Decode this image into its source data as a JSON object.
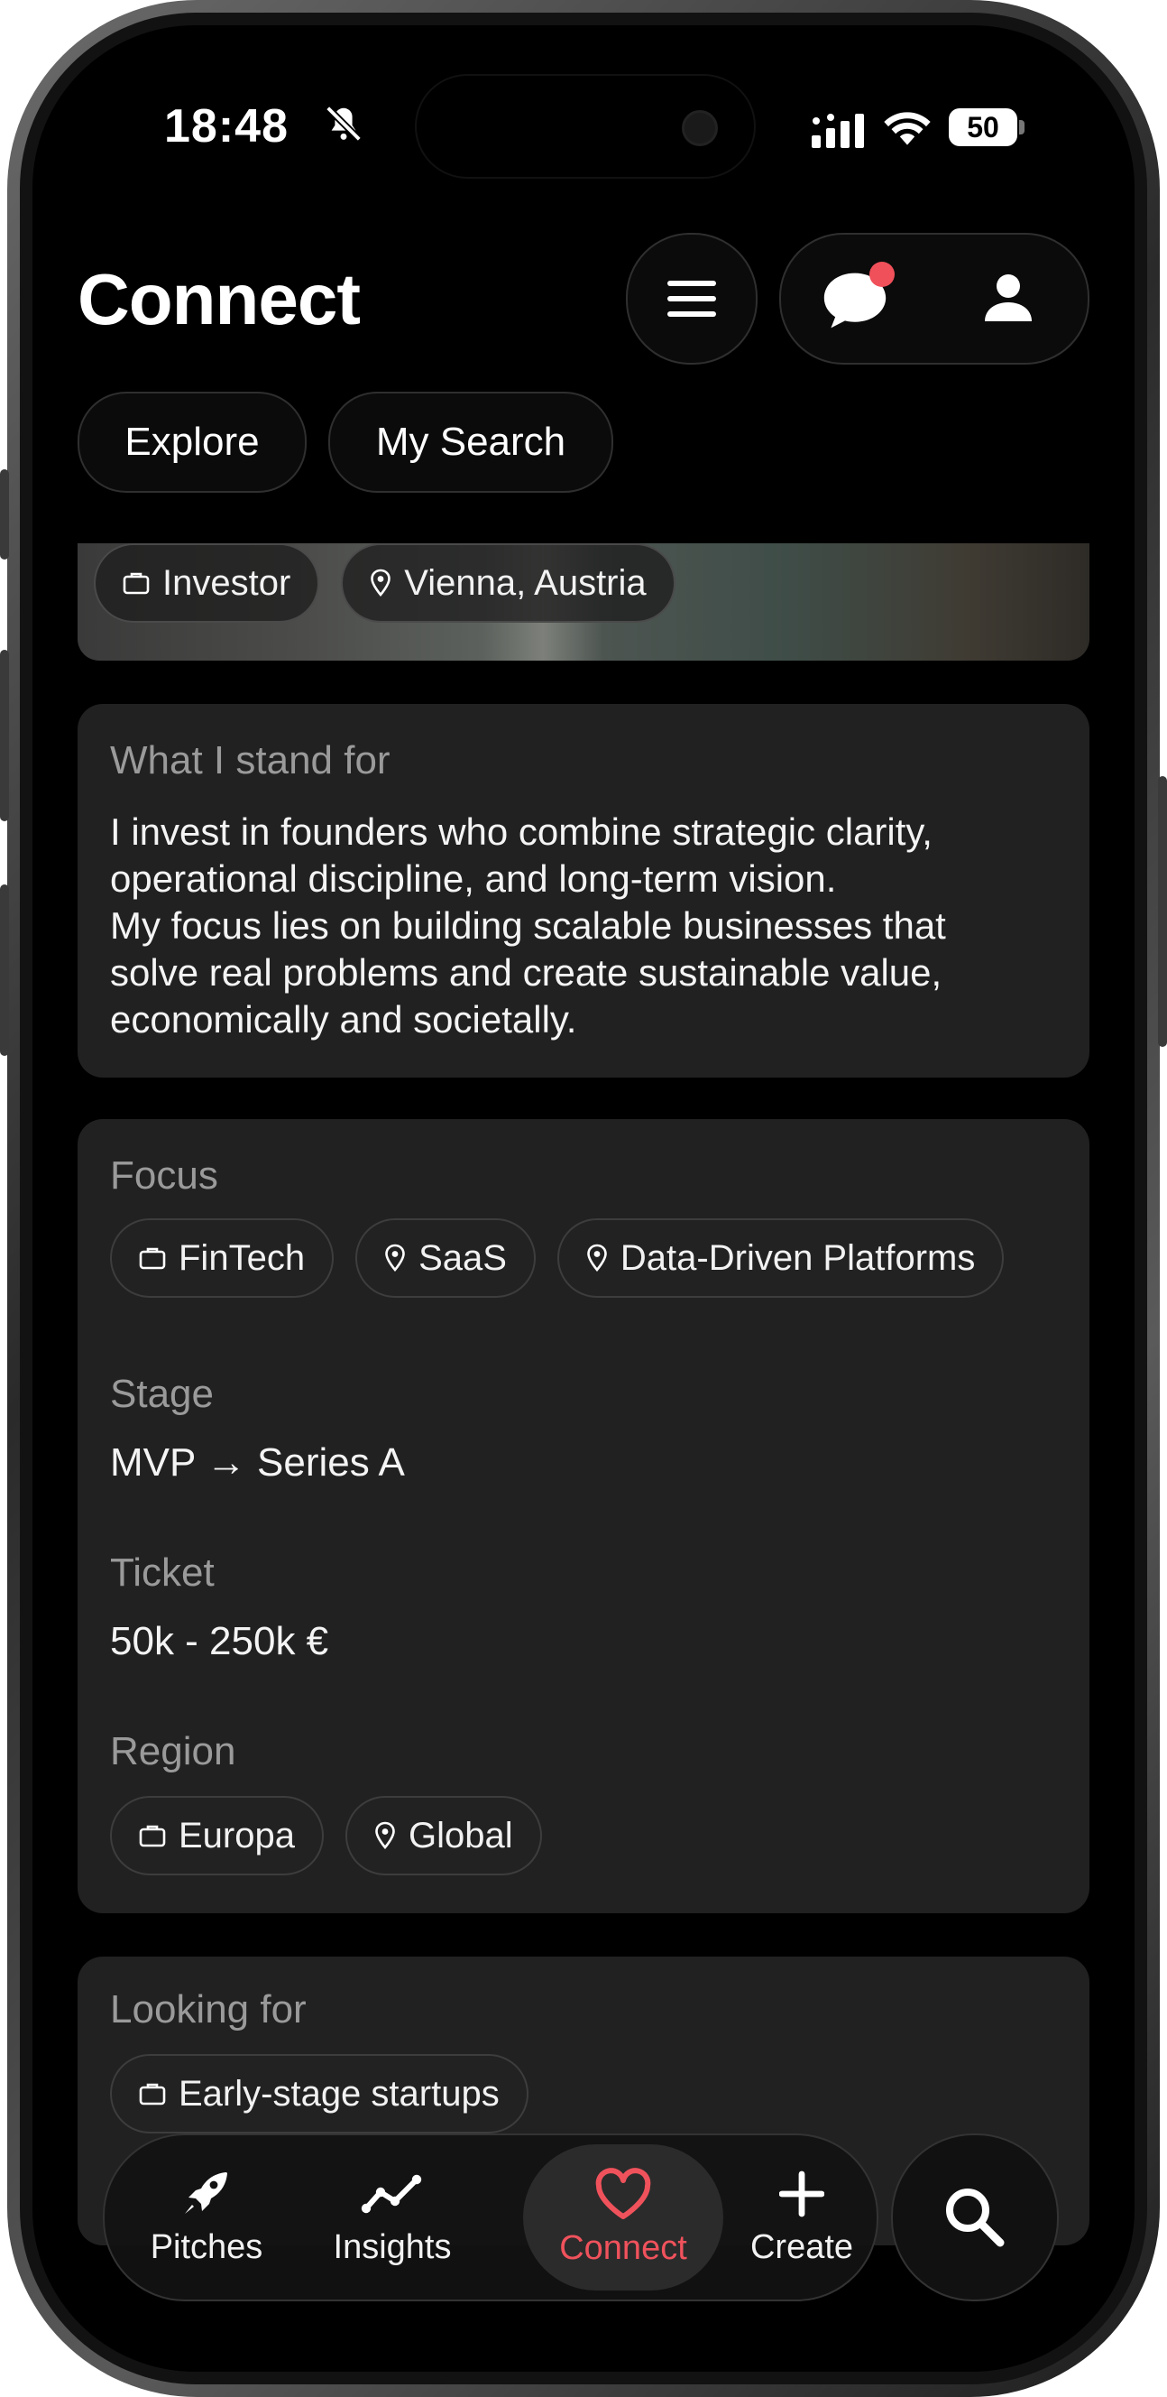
{
  "status_bar": {
    "time": "18:48",
    "battery": "50"
  },
  "header": {
    "title": "Connect"
  },
  "tabs": [
    {
      "label": "Explore"
    },
    {
      "label": "My Search"
    }
  ],
  "profile_tags": {
    "role": "Investor",
    "location": "Vienna, Austria"
  },
  "stand_for": {
    "label": "What I stand for",
    "lines": [
      "I invest in founders who combine strategic clarity,",
      "operational discipline, and long-term vision.",
      "My focus lies on building scalable businesses that",
      "solve real problems and create sustainable value,",
      "economically and societally."
    ]
  },
  "details": {
    "focus_label": "Focus",
    "focus_tags": [
      "FinTech",
      "SaaS",
      "Data-Driven Platforms"
    ],
    "stage_label": "Stage",
    "stage_value": "MVP → Series A",
    "ticket_label": "Ticket",
    "ticket_value": "50k - 250k €",
    "region_label": "Region",
    "region_tags": [
      "Europa",
      "Global"
    ]
  },
  "looking_for": {
    "label": "Looking for",
    "tags": [
      "Early-stage startups"
    ]
  },
  "bottom_nav": {
    "items": [
      {
        "label": "Pitches",
        "icon": "rocket-icon"
      },
      {
        "label": "Insights",
        "icon": "line-chart-icon"
      },
      {
        "label": "Connect",
        "icon": "heart-icon",
        "active": true
      },
      {
        "label": "Create",
        "icon": "plus-icon"
      }
    ],
    "active_color": "#f0525c"
  },
  "colors": {
    "notification_dot": "#f0505a",
    "card_bg": "#212121"
  }
}
